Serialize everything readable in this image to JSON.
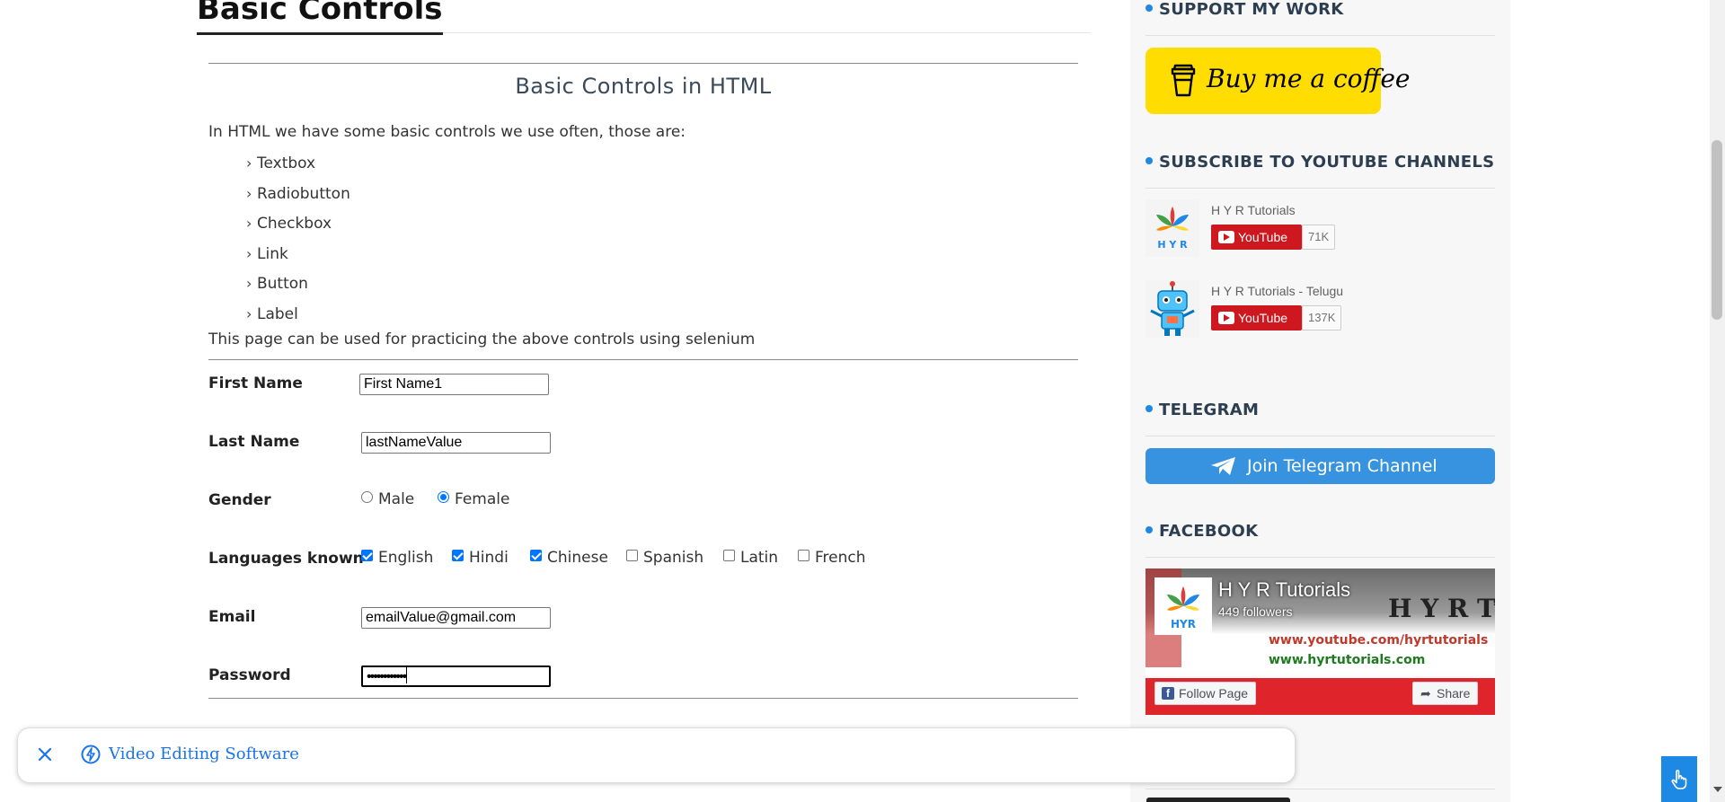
{
  "page": {
    "title": "Basic Controls",
    "subtitle": "Basic Controls in HTML",
    "intro": "In HTML we have some basic controls we use often, those are:",
    "controls_list": [
      "Textbox",
      "Radiobutton",
      "Checkbox",
      "Link",
      "Button",
      "Label"
    ],
    "practice_note": "This page can be used for practicing the above controls using selenium"
  },
  "form": {
    "first_name": {
      "label": "First Name",
      "value": "First Name1"
    },
    "last_name": {
      "label": "Last Name",
      "value": "lastNameValue"
    },
    "gender": {
      "label": "Gender",
      "options": [
        {
          "label": "Male",
          "checked": false
        },
        {
          "label": "Female",
          "checked": true
        }
      ]
    },
    "languages": {
      "label": "Languages known",
      "options": [
        {
          "label": "English",
          "checked": true
        },
        {
          "label": "Hindi",
          "checked": true
        },
        {
          "label": "Chinese",
          "checked": true
        },
        {
          "label": "Spanish",
          "checked": false
        },
        {
          "label": "Latin",
          "checked": false
        },
        {
          "label": "French",
          "checked": false
        }
      ]
    },
    "email": {
      "label": "Email",
      "value": "emailValue@gmail.com"
    },
    "password": {
      "label": "Password",
      "value": "••••••••••••"
    }
  },
  "sidebar": {
    "support_heading": "SUPPORT MY WORK",
    "coffee_label": "Buy me a coffee",
    "youtube_heading": "SUBSCRIBE TO YOUTUBE CHANNELS",
    "channels": [
      {
        "name": "H Y R Tutorials",
        "button": "YouTube",
        "count": "71K"
      },
      {
        "name": "H Y R Tutorials - Telugu",
        "button": "YouTube",
        "count": "137K"
      }
    ],
    "telegram_heading": "TELEGRAM",
    "telegram_button": "Join Telegram Channel",
    "facebook_heading": "FACEBOOK",
    "facebook": {
      "page_name": "H Y R Tutorials",
      "followers": "449 followers",
      "banner_text": "H Y R Tutorials",
      "url1": "www.youtube.com/hyrtutorials",
      "url2": "www.hyrtutorials.com",
      "logo_text": "HYR",
      "follow_label": "Follow Page",
      "share_label": "Share"
    }
  },
  "adbar": {
    "text": "Video Editing Software"
  },
  "colors": {
    "accent_blue": "#1e88e5",
    "coffee_yellow": "#ffdd00",
    "youtube_red": "#cc181e",
    "telegram_blue": "#3793e0",
    "checkbox_blue": "#0075ff",
    "ad_link_blue": "#1a73e8"
  },
  "icons": {
    "coffee": "coffee-cup-icon",
    "telegram": "paper-plane-icon",
    "youtube": "play-icon",
    "facebook": "facebook-icon",
    "share": "share-arrow-icon",
    "close": "close-icon",
    "bolt": "lightning-bolt-icon",
    "touch": "hand-pointer-icon"
  }
}
